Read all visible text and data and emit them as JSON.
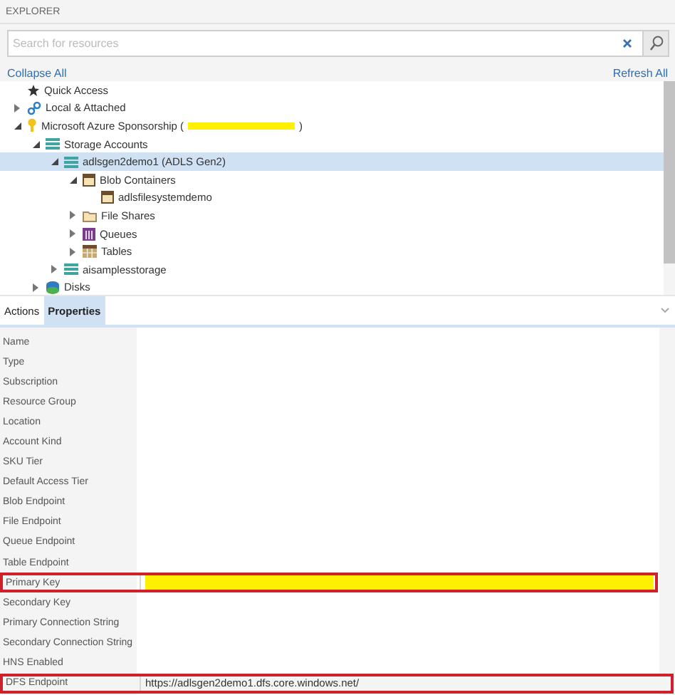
{
  "panel_title": "EXPLORER",
  "search": {
    "placeholder": "Search for resources"
  },
  "links": {
    "collapse": "Collapse All",
    "refresh": "Refresh All"
  },
  "tree": [
    {
      "label": "Quick Access",
      "kind": "star",
      "selected": false
    },
    {
      "label": "Local & Attached",
      "kind": "link",
      "expanded": false,
      "selected": false
    },
    {
      "label": "Microsoft Azure Sponsorship (",
      "label_end": ")",
      "redacted": true,
      "kind": "bulb",
      "expanded": true,
      "selected": false,
      "children": [
        {
          "label": "Storage Accounts",
          "kind": "storage",
          "expanded": true,
          "selected": false,
          "children": [
            {
              "label": "adlsgen2demo1 (ADLS Gen2)",
              "kind": "storage",
              "expanded": true,
              "selected": true,
              "children": [
                {
                  "label": "Blob Containers",
                  "kind": "container",
                  "expanded": true,
                  "selected": false,
                  "children": [
                    {
                      "label": "adlsfilesystemdemo",
                      "kind": "container",
                      "selected": false
                    }
                  ]
                },
                {
                  "label": "File Shares",
                  "kind": "folder",
                  "expanded": false,
                  "selected": false
                },
                {
                  "label": "Queues",
                  "kind": "queue",
                  "expanded": false,
                  "selected": false
                },
                {
                  "label": "Tables",
                  "kind": "table",
                  "expanded": false,
                  "selected": false
                }
              ]
            },
            {
              "label": "aisamplesstorage",
              "kind": "storage",
              "expanded": false,
              "selected": false
            }
          ]
        },
        {
          "label": "Disks",
          "kind": "disk",
          "expanded": false,
          "selected": false
        }
      ]
    }
  ],
  "tabs": [
    {
      "label": "Actions",
      "selected": false
    },
    {
      "label": "Properties",
      "selected": true
    }
  ],
  "properties": [
    {
      "name": "Name",
      "highlighted": false
    },
    {
      "name": "Type",
      "highlighted": false
    },
    {
      "name": "Subscription",
      "highlighted": false
    },
    {
      "name": "Resource Group",
      "highlighted": false
    },
    {
      "name": "Location",
      "highlighted": false
    },
    {
      "name": "Account Kind",
      "highlighted": false
    },
    {
      "name": "SKU Tier",
      "highlighted": false
    },
    {
      "name": "Default Access Tier",
      "highlighted": false
    },
    {
      "name": "Blob Endpoint",
      "highlighted": false
    },
    {
      "name": "File Endpoint",
      "highlighted": false
    },
    {
      "name": "Queue Endpoint",
      "highlighted": false
    },
    {
      "name": "Table Endpoint",
      "highlighted": false
    },
    {
      "name": "Primary Key",
      "highlighted": true,
      "redacted": true
    },
    {
      "name": "Secondary Key",
      "highlighted": false
    },
    {
      "name": "Primary Connection String",
      "highlighted": false
    },
    {
      "name": "Secondary Connection String",
      "highlighted": false
    },
    {
      "name": "HNS Enabled",
      "highlighted": false
    },
    {
      "name": "DFS Endpoint",
      "highlighted": true,
      "value": "https://adlsgen2demo1.dfs.core.windows.net/"
    }
  ]
}
